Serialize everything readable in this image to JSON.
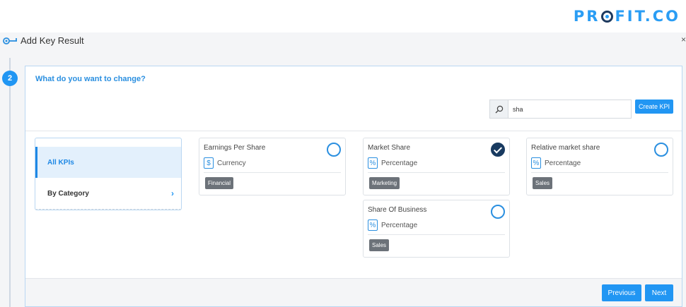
{
  "brand": {
    "logo_text_left": "PR",
    "logo_text_right": "FIT.CO"
  },
  "header": {
    "title": "Add Key Result",
    "close": "×"
  },
  "step": {
    "number": "2",
    "question": "What do you want to change?"
  },
  "search": {
    "value": "sha",
    "placeholder": ""
  },
  "actions": {
    "create_kpi": "Create KPI",
    "previous": "Previous",
    "next": "Next"
  },
  "nav": {
    "items": [
      {
        "label": "All KPIs",
        "active": true
      },
      {
        "label": "By Category",
        "active": false,
        "chevron": "›"
      }
    ]
  },
  "kpis": [
    {
      "name": "Earnings Per Share",
      "type_icon": "$",
      "type": "Currency",
      "tag": "Financial",
      "selected": false
    },
    {
      "name": "Market Share",
      "type_icon": "%",
      "type": "Percentage",
      "tag": "Marketing",
      "selected": true
    },
    {
      "name": "Relative market share",
      "type_icon": "%",
      "type": "Percentage",
      "tag": "Sales",
      "selected": false
    },
    {
      "name": "Share Of Business",
      "type_icon": "%",
      "type": "Percentage",
      "tag": "Sales",
      "selected": false
    }
  ],
  "colors": {
    "accent": "#2196f3",
    "selected": "#183a60",
    "tag": "#6c7279"
  }
}
